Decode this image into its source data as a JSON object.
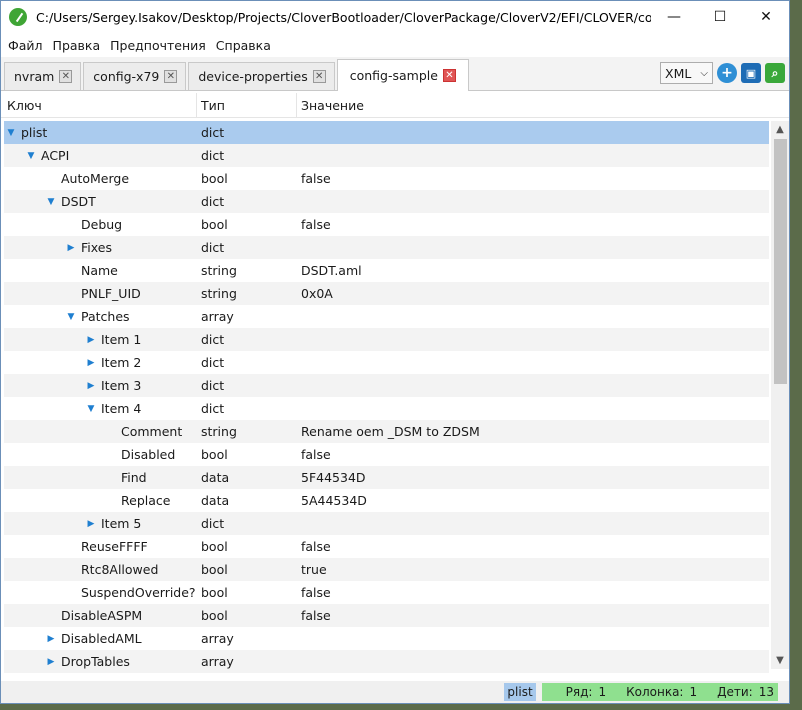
{
  "window": {
    "title": "C:/Users/Sergey.Isakov/Desktop/Projects/CloverBootloader/CloverPackage/CloverV2/EFI/CLOVER/config-sample.plist",
    "minimize": "—",
    "maximize": "☐",
    "close": "✕"
  },
  "menu": [
    "Файл",
    "Правка",
    "Предпочтения",
    "Справка"
  ],
  "tabs": [
    {
      "label": "nvram"
    },
    {
      "label": "config-x79"
    },
    {
      "label": "device-properties"
    },
    {
      "label": "config-sample"
    }
  ],
  "toolbar": {
    "format": "XML",
    "add_icon": "plus",
    "save_icon": "floppy",
    "search_icon": "magnifier"
  },
  "columns": {
    "key": "Ключ",
    "type": "Тип",
    "value": "Значение"
  },
  "rows": [
    {
      "key": "plist",
      "type": "dict",
      "value": "",
      "depth": 0,
      "expander": "expanded"
    },
    {
      "key": "ACPI",
      "type": "dict",
      "value": "",
      "depth": 1,
      "expander": "expanded"
    },
    {
      "key": "AutoMerge",
      "type": "bool",
      "value": "false",
      "depth": 2,
      "expander": "none"
    },
    {
      "key": "DSDT",
      "type": "dict",
      "value": "",
      "depth": 2,
      "expander": "expanded"
    },
    {
      "key": "Debug",
      "type": "bool",
      "value": "false",
      "depth": 3,
      "expander": "none"
    },
    {
      "key": "Fixes",
      "type": "dict",
      "value": "",
      "depth": 3,
      "expander": "collapsed"
    },
    {
      "key": "Name",
      "type": "string",
      "value": "DSDT.aml",
      "depth": 3,
      "expander": "none"
    },
    {
      "key": "PNLF_UID",
      "type": "string",
      "value": "0x0A",
      "depth": 3,
      "expander": "none"
    },
    {
      "key": "Patches",
      "type": "array",
      "value": "",
      "depth": 3,
      "expander": "expanded"
    },
    {
      "key": "Item 1",
      "type": "dict",
      "value": "",
      "depth": 4,
      "expander": "collapsed"
    },
    {
      "key": "Item 2",
      "type": "dict",
      "value": "",
      "depth": 4,
      "expander": "collapsed"
    },
    {
      "key": "Item 3",
      "type": "dict",
      "value": "",
      "depth": 4,
      "expander": "collapsed"
    },
    {
      "key": "Item 4",
      "type": "dict",
      "value": "",
      "depth": 4,
      "expander": "expanded"
    },
    {
      "key": "Comment",
      "type": "string",
      "value": "Rename oem _DSM to ZDSM",
      "depth": 5,
      "expander": "none"
    },
    {
      "key": "Disabled",
      "type": "bool",
      "value": "false",
      "depth": 5,
      "expander": "none"
    },
    {
      "key": "Find",
      "type": "data",
      "value": "5F44534D",
      "depth": 5,
      "expander": "none"
    },
    {
      "key": "Replace",
      "type": "data",
      "value": "5A44534D",
      "depth": 5,
      "expander": "none"
    },
    {
      "key": "Item 5",
      "type": "dict",
      "value": "",
      "depth": 4,
      "expander": "collapsed"
    },
    {
      "key": "ReuseFFFF",
      "type": "bool",
      "value": "false",
      "depth": 3,
      "expander": "none"
    },
    {
      "key": "Rtc8Allowed",
      "type": "bool",
      "value": "true",
      "depth": 3,
      "expander": "none"
    },
    {
      "key": "SuspendOverride?",
      "type": "bool",
      "value": "false",
      "depth": 3,
      "expander": "none"
    },
    {
      "key": "DisableASPM",
      "type": "bool",
      "value": "false",
      "depth": 2,
      "expander": "none"
    },
    {
      "key": "DisabledAML",
      "type": "array",
      "value": "",
      "depth": 2,
      "expander": "collapsed"
    },
    {
      "key": "DropTables",
      "type": "array",
      "value": "",
      "depth": 2,
      "expander": "collapsed"
    }
  ],
  "status": {
    "path": "plist",
    "row_label": "Ряд:",
    "row": "1",
    "col_label": "Колонка:",
    "col": "1",
    "children_label": "Дети:",
    "children": "13"
  }
}
